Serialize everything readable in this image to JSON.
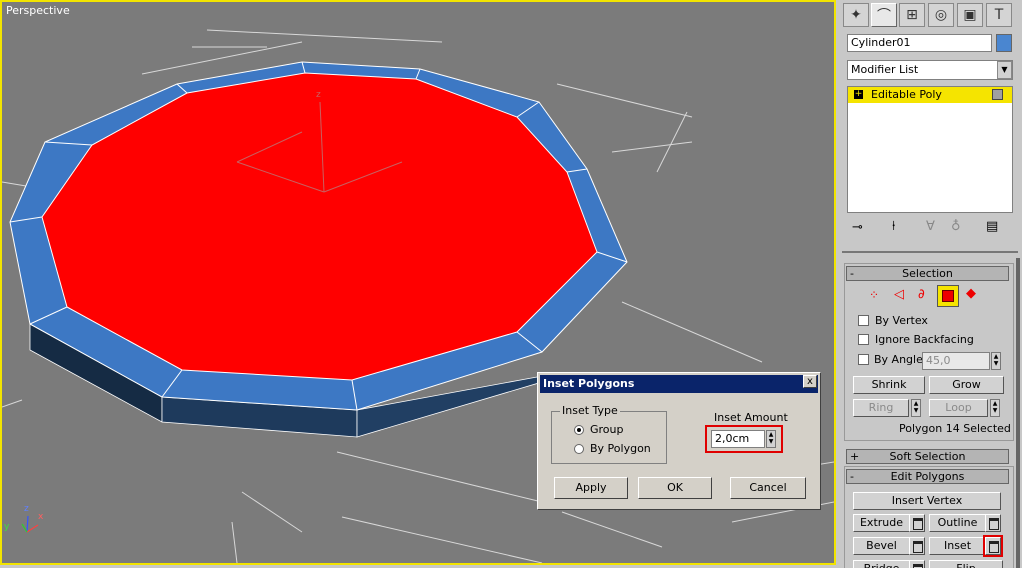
{
  "viewport": {
    "label": "Perspective",
    "axis_labels": {
      "z": "z",
      "x": "x",
      "y": "y"
    },
    "colors": {
      "background": "#7b7b7b",
      "selected_faces": "#ff0000",
      "inset_ring": "#3d78c4",
      "side": "#1c3552",
      "active_border": "#f2e400"
    }
  },
  "command_panel": {
    "tabs": [
      {
        "name": "create-tab",
        "glyph": "✦"
      },
      {
        "name": "modify-tab",
        "glyph": "⌒"
      },
      {
        "name": "hierarchy-tab",
        "glyph": "⊞"
      },
      {
        "name": "motion-tab",
        "glyph": "◎"
      },
      {
        "name": "display-tab",
        "glyph": "▣"
      },
      {
        "name": "utilities-tab",
        "glyph": "T"
      }
    ],
    "object_name": "Cylinder01",
    "object_color": "#4a86d0",
    "modifier_list": "Modifier List",
    "stack_item": "Editable Poly",
    "stack_icons": [
      "pin-stack",
      "show-end-result",
      "make-unique",
      "remove-modifier",
      "configure-modifier-sets"
    ]
  },
  "selection": {
    "header": "Selection",
    "sign": "-",
    "subobject_levels": [
      "vertex",
      "edge",
      "border",
      "polygon",
      "element"
    ],
    "active_level": "polygon",
    "by_vertex": "By Vertex",
    "ignore_backfacing": "Ignore Backfacing",
    "by_angle": "By Angle:",
    "angle_value": "45,0",
    "shrink": "Shrink",
    "grow": "Grow",
    "ring": "Ring",
    "loop": "Loop",
    "status": "Polygon 14 Selected"
  },
  "soft_selection": {
    "header": "Soft Selection",
    "sign": "+"
  },
  "edit_polygons": {
    "header": "Edit Polygons",
    "sign": "-",
    "insert_vertex": "Insert Vertex",
    "extrude": "Extrude",
    "outline": "Outline",
    "bevel": "Bevel",
    "inset": "Inset",
    "bridge": "Bridge",
    "flip": "Flip"
  },
  "dialog": {
    "title": "Inset Polygons",
    "close": "x",
    "inset_type_label": "Inset Type",
    "group": "Group",
    "by_polygon": "By Polygon",
    "selected_type": "group",
    "inset_amount_label": "Inset Amount",
    "inset_amount_value": "2,0cm",
    "highlight_color": "#e00000",
    "apply": "Apply",
    "ok": "OK",
    "cancel": "Cancel"
  }
}
